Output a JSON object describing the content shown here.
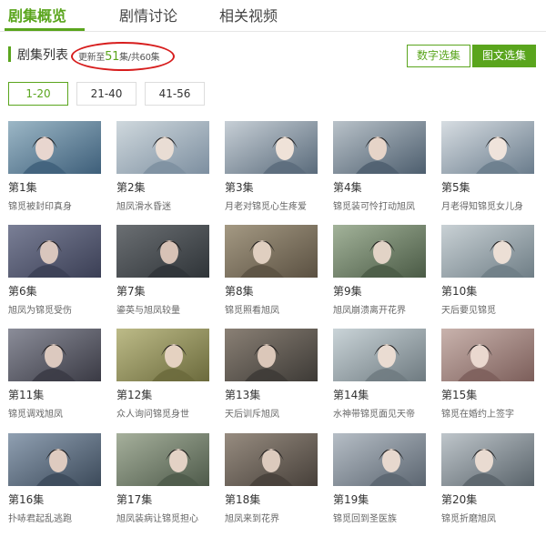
{
  "tabs": [
    {
      "label": "剧集概览",
      "active": true
    },
    {
      "label": "剧情讨论",
      "active": false
    },
    {
      "label": "相关视频",
      "active": false
    }
  ],
  "list": {
    "title": "剧集列表",
    "update_prefix": "更新至",
    "update_current": "51",
    "update_suffix": "集/共60集"
  },
  "modes": [
    "数字选集",
    "图文选集"
  ],
  "ranges": [
    {
      "label": "1-20",
      "active": true
    },
    {
      "label": "21-40",
      "active": false
    },
    {
      "label": "41-56",
      "active": false
    }
  ],
  "episodes": [
    {
      "title": "第1集",
      "desc": "锦觅被封印真身"
    },
    {
      "title": "第2集",
      "desc": "旭凤滑水昏迷"
    },
    {
      "title": "第3集",
      "desc": "月老对锦觅心生疼爱"
    },
    {
      "title": "第4集",
      "desc": "锦觅装可怜打动旭凤"
    },
    {
      "title": "第5集",
      "desc": "月老得知锦觅女儿身"
    },
    {
      "title": "第6集",
      "desc": "旭凤为锦觅受伤"
    },
    {
      "title": "第7集",
      "desc": "鎏英与旭凤较量"
    },
    {
      "title": "第8集",
      "desc": "锦觅照看旭凤"
    },
    {
      "title": "第9集",
      "desc": "旭凤崩溃离开花界"
    },
    {
      "title": "第10集",
      "desc": "天后要见锦觅"
    },
    {
      "title": "第11集",
      "desc": "锦觅调戏旭凤"
    },
    {
      "title": "第12集",
      "desc": "众人询问锦觅身世"
    },
    {
      "title": "第13集",
      "desc": "天后训斥旭凤"
    },
    {
      "title": "第14集",
      "desc": "水神带锦觅面见天帝"
    },
    {
      "title": "第15集",
      "desc": "锦觅在婚约上签字"
    },
    {
      "title": "第16集",
      "desc": "扑哧君起乱逃跑"
    },
    {
      "title": "第17集",
      "desc": "旭凤装病让锦觅担心"
    },
    {
      "title": "第18集",
      "desc": "旭凤来到花界"
    },
    {
      "title": "第19集",
      "desc": "锦觅回到圣医族"
    },
    {
      "title": "第20集",
      "desc": "锦觅折磨旭凤"
    }
  ],
  "colors": {
    "accent": "#5aa51d",
    "annotation": "#d71d1d"
  }
}
